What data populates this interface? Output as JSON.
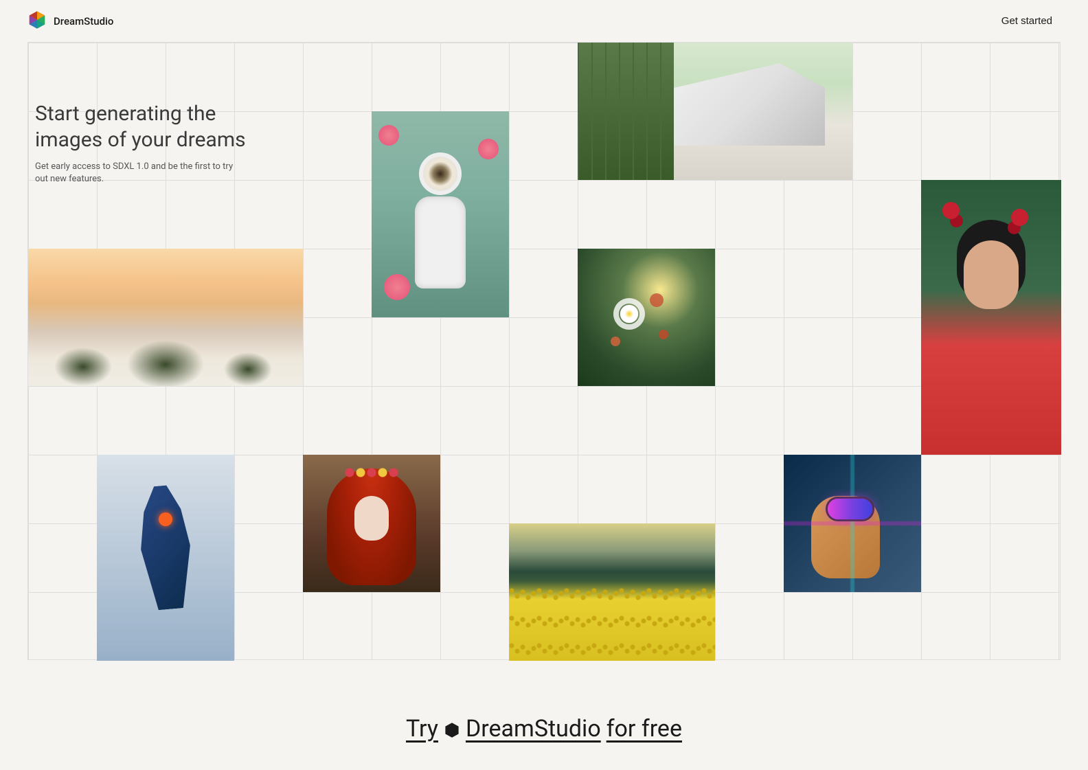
{
  "header": {
    "brand": "DreamStudio",
    "get_started": "Get started"
  },
  "hero": {
    "title": "Start generating the images of your dreams",
    "subtitle": "Get early access to SDXL 1.0 and be the first to try out new features."
  },
  "gallery_tiles": [
    {
      "name": "beach-sunset"
    },
    {
      "name": "astronaut-roses"
    },
    {
      "name": "modern-house"
    },
    {
      "name": "wildflowers"
    },
    {
      "name": "frida-portrait"
    },
    {
      "name": "scifi-robot"
    },
    {
      "name": "redhair-woman"
    },
    {
      "name": "yellow-field"
    },
    {
      "name": "dog-vr"
    }
  ],
  "cta": {
    "prefix": "Try",
    "brand": "DreamStudio",
    "suffix": "for free"
  }
}
